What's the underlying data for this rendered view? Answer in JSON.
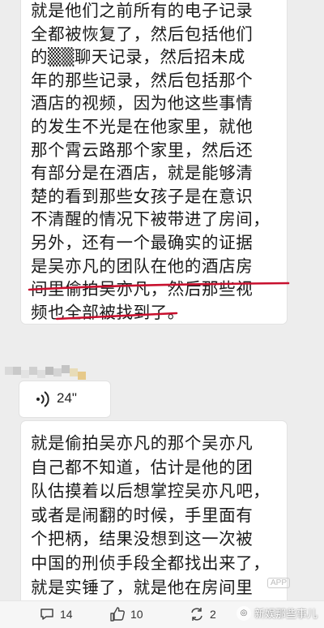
{
  "message1": {
    "lines": [
      "就是他们之前所有的电子记录",
      "全都被恢复了，然后包括他们",
      "的▒▒聊天记录，然后招未成",
      "年的那些记录，然后包括那个",
      "酒店的视频，因为他这些事情",
      "的发生不光是在他家里，就他",
      "那个霄云路那个家里，然后还",
      "有部分是在酒店，就是能够清",
      "楚的看到那些女孩子是在意识",
      "不清醒的情况下被带进了房间，",
      "另外，还有一个最确实的证据",
      "是吴亦凡的团队在他的酒店房",
      "间里偷拍吴亦凡，然后那些视",
      "频也全部被找到了。"
    ]
  },
  "voice_message": {
    "duration": "24\""
  },
  "message2": {
    "lines": [
      "就是偷拍吴亦凡的那个吴亦凡",
      "自己都不知道，估计是他的团",
      "队估摸着以后想掌控吴亦凡吧，",
      "或者是闹翻的时候，手里面有",
      "个把柄，结果没想到这一次被",
      "中国的刑侦手段全都找出来了，",
      "就是实锤了，就是他在房间里"
    ]
  },
  "footer": {
    "comments": "14",
    "likes": "10",
    "reposts": "2"
  },
  "watermark": {
    "text": "新娱那些事儿",
    "app_label": "APP"
  },
  "colors": {
    "underline": "#c8102e",
    "background": "#ededed",
    "bubble": "#ffffff"
  }
}
